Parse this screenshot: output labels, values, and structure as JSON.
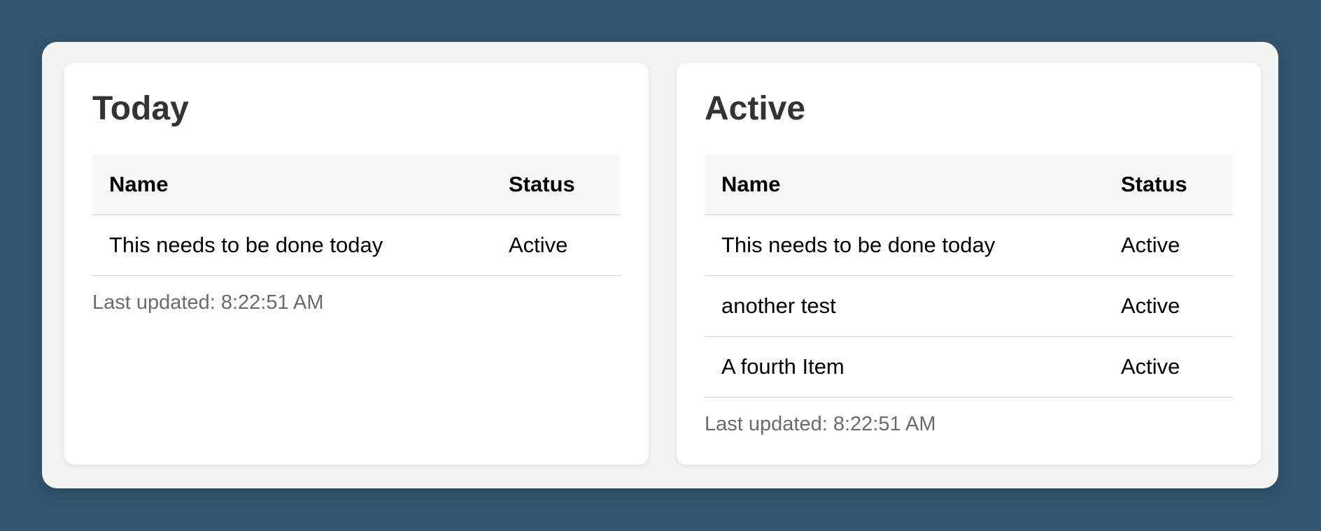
{
  "cards": [
    {
      "title": "Today",
      "columns": {
        "name": "Name",
        "status": "Status"
      },
      "rows": [
        {
          "name": "This needs to be done today",
          "status": "Active"
        }
      ],
      "last_updated": "Last updated: 8:22:51 AM"
    },
    {
      "title": "Active",
      "columns": {
        "name": "Name",
        "status": "Status"
      },
      "rows": [
        {
          "name": "This needs to be done today",
          "status": "Active"
        },
        {
          "name": "another test",
          "status": "Active"
        },
        {
          "name": "A fourth Item",
          "status": "Active"
        }
      ],
      "last_updated": "Last updated: 8:22:51 AM"
    }
  ],
  "colors": {
    "background": "#33566e",
    "panel": "#f3f3f4",
    "card": "#ffffff",
    "header_row": "#f6f7f9",
    "title_text": "#333333",
    "muted_text": "#6b6b6b"
  }
}
